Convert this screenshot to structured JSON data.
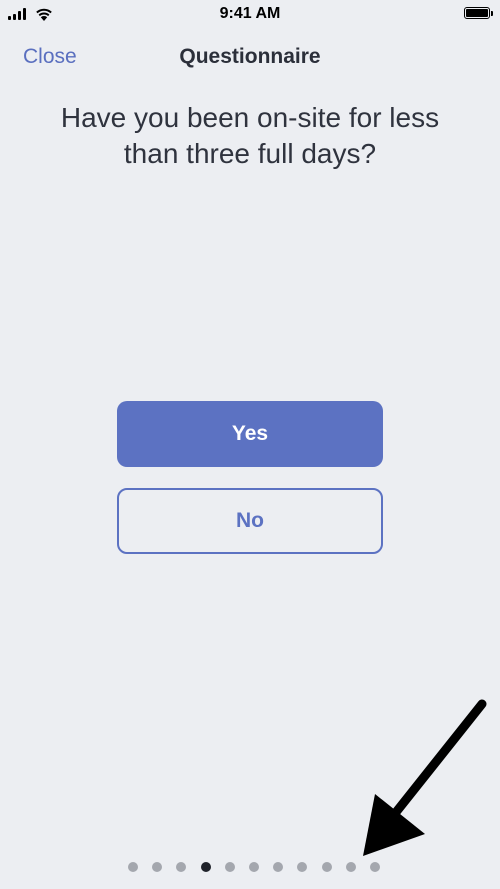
{
  "status_bar": {
    "time": "9:41 AM",
    "signal_icon": "signal-bars-icon",
    "wifi_icon": "wifi-icon",
    "battery_icon": "battery-icon"
  },
  "nav": {
    "close_label": "Close",
    "title": "Questionnaire"
  },
  "question": {
    "text": "Have you been on-site for less than three full days?"
  },
  "answers": {
    "yes_label": "Yes",
    "no_label": "No"
  },
  "pagination": {
    "total_pages": 11,
    "current_page": 4
  },
  "annotation": {
    "icon": "arrow-icon",
    "color": "#000000"
  },
  "colors": {
    "accent": "#5c72c2",
    "background": "#eceef2",
    "dot_inactive": "#a4a7ae",
    "dot_active": "#1f222a"
  }
}
